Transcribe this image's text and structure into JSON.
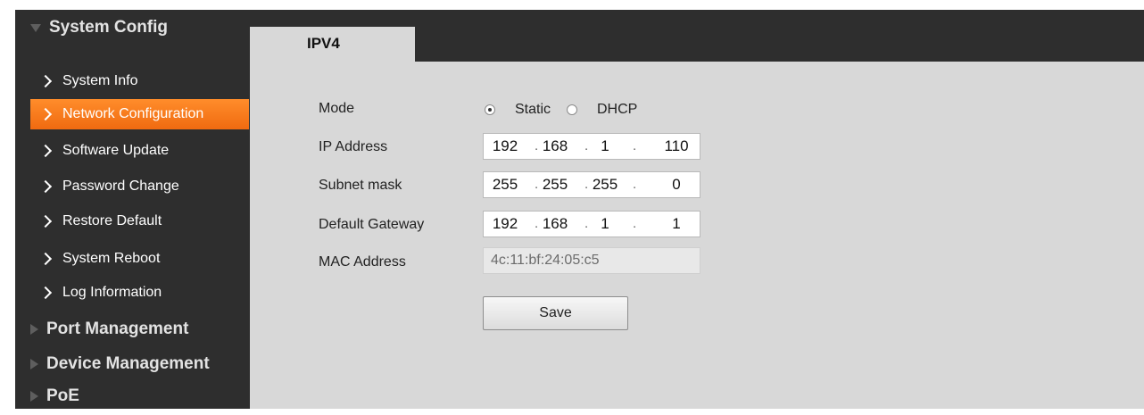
{
  "sidebar": {
    "system_config": "System Config",
    "items": [
      {
        "label": "System Info"
      },
      {
        "label": "Network Configuration"
      },
      {
        "label": "Software Update"
      },
      {
        "label": "Password Change"
      },
      {
        "label": "Restore Default"
      },
      {
        "label": "System Reboot"
      },
      {
        "label": "Log Information"
      }
    ],
    "port_management": "Port Management",
    "device_management": "Device Management",
    "poe": "PoE"
  },
  "tab": {
    "label": "IPV4"
  },
  "form": {
    "mode_label": "Mode",
    "mode_selected": "Static",
    "mode_options": [
      "Static",
      "DHCP"
    ],
    "ip_label": "IP Address",
    "ip": [
      "192",
      "168",
      "1",
      "110"
    ],
    "subnet_label": "Subnet mask",
    "subnet": [
      "255",
      "255",
      "255",
      "0"
    ],
    "gateway_label": "Default Gateway",
    "gateway": [
      "192",
      "168",
      "1",
      "1"
    ],
    "mac_label": "MAC Address",
    "mac": "4c:11:bf:24:05:c5",
    "dot": ".",
    "save_label": "Save"
  },
  "colors": {
    "sidebar_bg": "#2e2e2e",
    "active_item": "#f47b1c",
    "content_bg": "#d8d8d8"
  }
}
